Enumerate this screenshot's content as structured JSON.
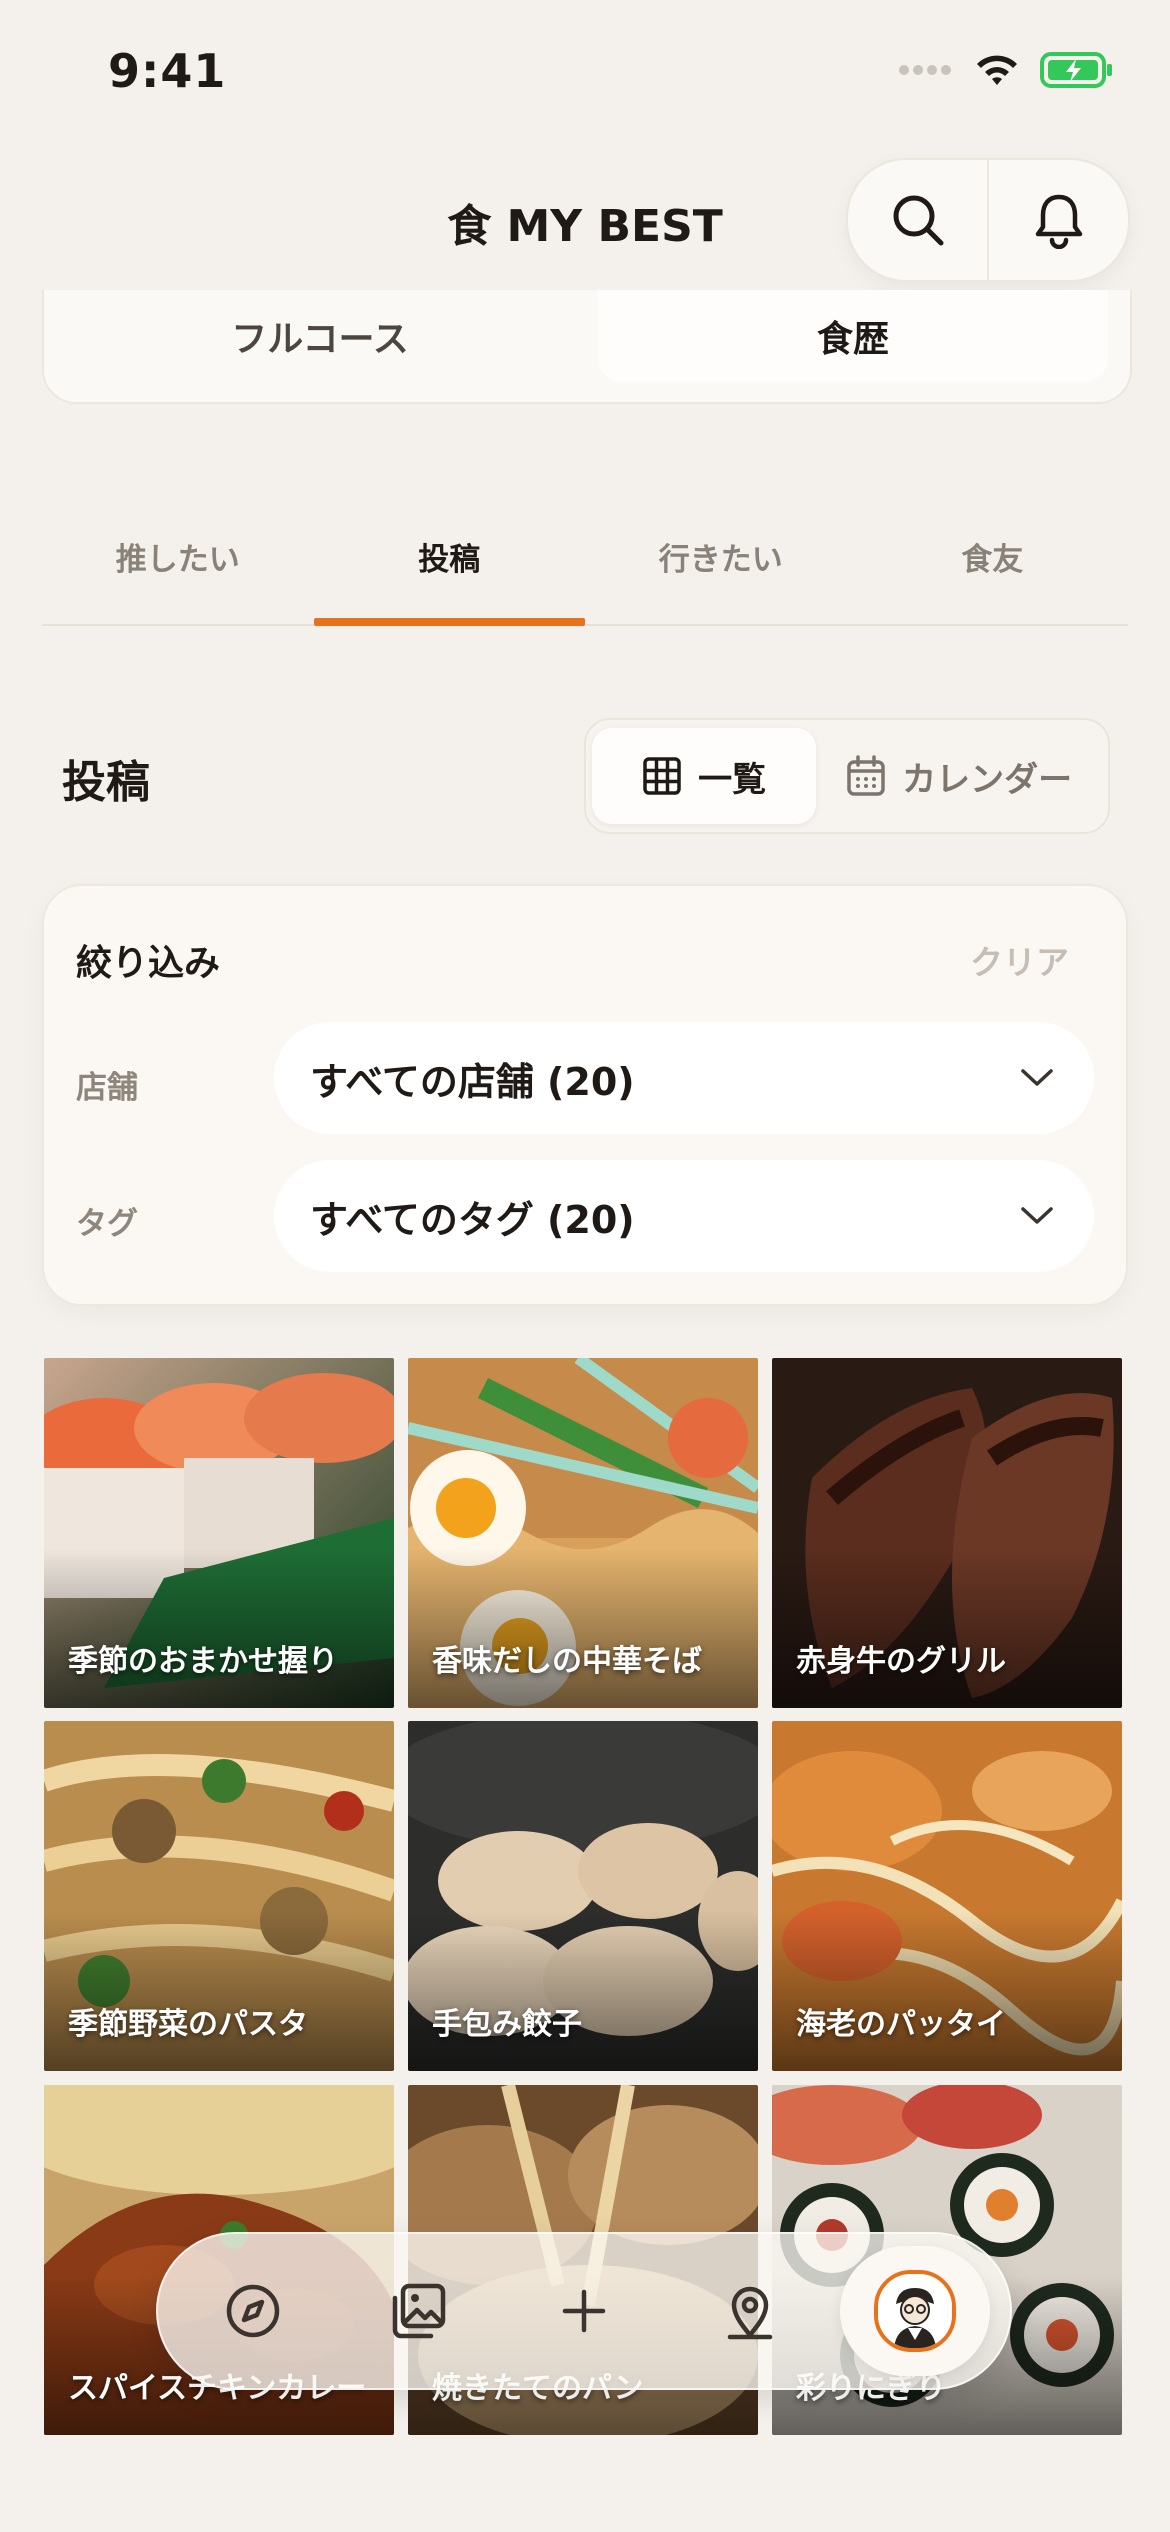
{
  "status": {
    "time": "9:41"
  },
  "header": {
    "title": "食 MY BEST"
  },
  "top_segment": {
    "left": "フルコース",
    "right": "食歴"
  },
  "tabs": [
    {
      "label": "推したい"
    },
    {
      "label": "投稿"
    },
    {
      "label": "行きたい"
    },
    {
      "label": "食友"
    }
  ],
  "section": {
    "title": "投稿"
  },
  "view_toggle": {
    "list": "一覧",
    "calendar": "カレンダー"
  },
  "filter": {
    "title": "絞り込み",
    "clear": "クリア",
    "store_label": "店舗",
    "store_value": "すべての店舗 (20)",
    "tag_label": "タグ",
    "tag_value": "すべてのタグ (20)"
  },
  "posts": [
    {
      "caption": "季節のおまかせ握り"
    },
    {
      "caption": "香味だしの中華そば"
    },
    {
      "caption": "赤身牛のグリル"
    },
    {
      "caption": "季節野菜のパスタ"
    },
    {
      "caption": "手包み餃子"
    },
    {
      "caption": "海老のパッタイ"
    },
    {
      "caption": "スパイスチキンカレー"
    },
    {
      "caption": "焼きたてのパン"
    },
    {
      "caption": "彩りにぎり"
    }
  ],
  "icons": {
    "wifi": "wifi-icon",
    "battery": "battery-icon",
    "search": "search-icon",
    "bell": "bell-icon",
    "grid": "grid-icon",
    "calendar": "calendar-icon",
    "chevron": "chevron-down-icon",
    "compass": "compass-icon",
    "gallery": "gallery-icon",
    "plus": "plus-icon",
    "pin": "location-pin-icon"
  },
  "colors": {
    "accent": "#e8721c",
    "background": "#f4f1ec",
    "battery": "#34c759"
  }
}
